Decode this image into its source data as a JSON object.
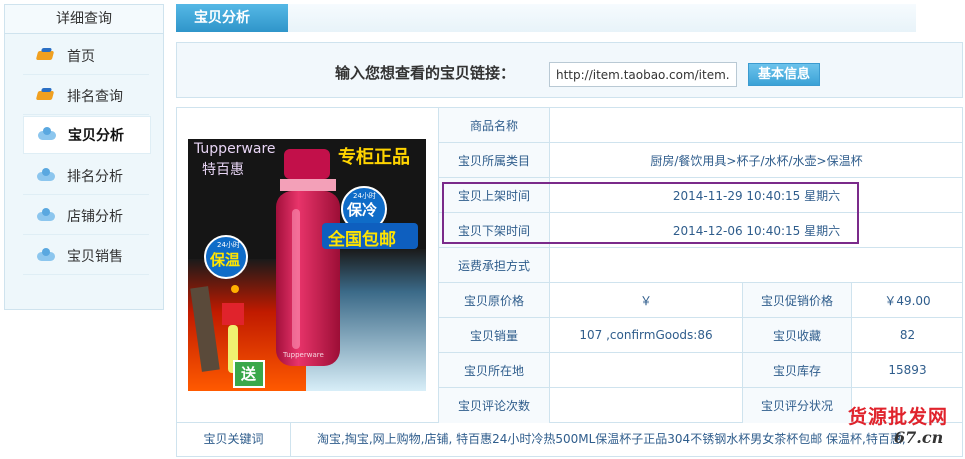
{
  "sidebar": {
    "title": "详细查询",
    "items": [
      {
        "label": "首页",
        "icon": "hat-icon"
      },
      {
        "label": "排名查询",
        "icon": "hat-icon"
      },
      {
        "label": "宝贝分析",
        "icon": "cloud-icon",
        "active": true
      },
      {
        "label": "排名分析",
        "icon": "cloud-icon"
      },
      {
        "label": "店铺分析",
        "icon": "cloud-icon"
      },
      {
        "label": "宝贝销售",
        "icon": "cloud-icon"
      }
    ]
  },
  "tab": {
    "label": "宝贝分析"
  },
  "search": {
    "label": "输入您想查看的宝贝链接：",
    "value": "http://item.taobao.com/item.",
    "button": "基本信息"
  },
  "product_image": {
    "brand_en": "Tupperware",
    "brand_cn": "特百惠",
    "badge_top": "专柜正品",
    "badge_cold_small": "24小时",
    "badge_cold": "保冷",
    "badge_shipping": "全国包邮",
    "badge_warm_small": "24小时",
    "badge_warm": "保温",
    "badge_gift": "送",
    "bottle_text": "Tupperware"
  },
  "details": {
    "name_label": "商品名称",
    "name_value": "",
    "category_label": "宝贝所属类目",
    "category_value": "厨房/餐饮用具>杯子/水杯/水壶>保温杯",
    "list_time_label": "宝贝上架时间",
    "list_time_value": "2014-11-29 10:40:15 星期六",
    "delist_time_label": "宝贝下架时间",
    "delist_time_value": "2014-12-06 10:40:15 星期六",
    "shipping_label": "运费承担方式",
    "shipping_value": "",
    "original_price_label": "宝贝原价格",
    "original_price_value": "￥",
    "promo_price_label": "宝贝促销价格",
    "promo_price_value": "￥49.00",
    "sales_label": "宝贝销量",
    "sales_value": "107 ,confirmGoods:86",
    "favorites_label": "宝贝收藏",
    "favorites_value": "82",
    "location_label": "宝贝所在地",
    "location_value": "",
    "stock_label": "宝贝库存",
    "stock_value": "15893",
    "reviews_label": "宝贝评论次数",
    "reviews_value": "",
    "rating_label": "宝贝评分状况",
    "rating_value": ""
  },
  "keywords": {
    "label": "宝贝关键词",
    "value": "淘宝,掏宝,网上购物,店铺, 特百惠24小时冷热500ML保温杯子正品304不锈钢水杯男女茶杯包邮 保温杯,特百惠,"
  },
  "watermark": {
    "top": "货源批发网",
    "bottom": "67.cn"
  },
  "colors": {
    "accent": "#3ba2d6",
    "highlight": "#7a2a8a",
    "label_text": "#2f5d8c",
    "watermark": "#e0232c"
  }
}
